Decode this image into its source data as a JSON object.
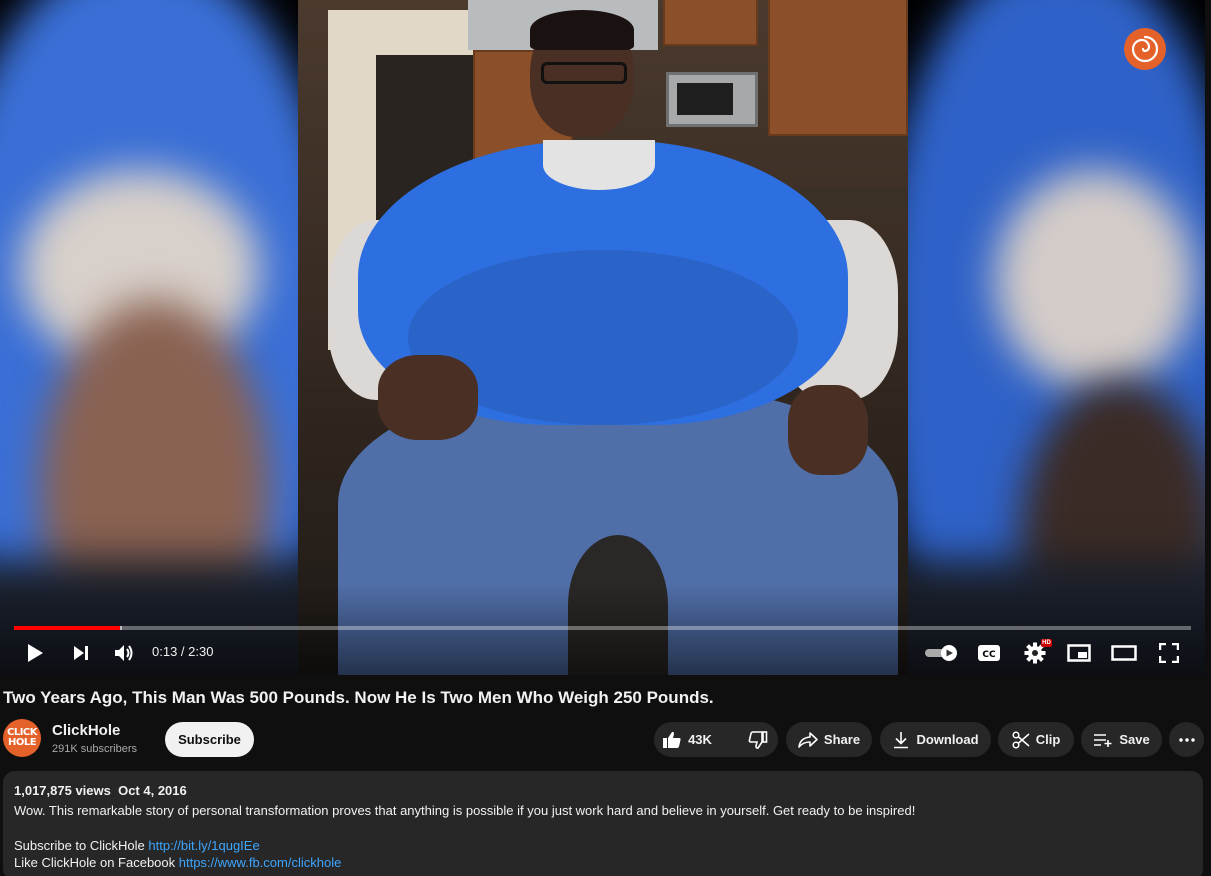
{
  "player": {
    "current_time": "0:13",
    "time_separator": " / ",
    "duration": "2:30",
    "progress_played": 0.09,
    "progress_loaded": 0.092,
    "hd_badge": "HD",
    "controls": [
      "play-icon",
      "next-icon",
      "volume-icon",
      "autoplay-toggle",
      "cc-icon",
      "settings-icon",
      "miniplayer-icon",
      "theater-icon",
      "fullscreen-icon"
    ]
  },
  "video": {
    "title": "Two Years Ago, This Man Was 500 Pounds. Now He Is Two Men Who Weigh 250 Pounds."
  },
  "channel": {
    "name": "ClickHole",
    "subscribers": "291K subscribers",
    "avatar_line1": "CLICK",
    "avatar_line2": "HOLE",
    "subscribe_label": "Subscribe",
    "brand_color": "#e4622a"
  },
  "actions": {
    "likes": "43K",
    "share": "Share",
    "download": "Download",
    "clip": "Clip",
    "save": "Save"
  },
  "description": {
    "views": "1,017,875 views",
    "date": "Oct 4, 2016",
    "text": "Wow. This remarkable story of personal transformation proves that anything is possible if you just work hard and believe in yourself. Get ready to be inspired!",
    "subscribe_label": "Subscribe to ClickHole ",
    "subscribe_link": "http://bit.ly/1qugIEe",
    "facebook_label": "Like ClickHole on Facebook ",
    "facebook_link": "https://www.fb.com/clickhole"
  },
  "colors": {
    "background": "#0f0f0f",
    "pill": "#272727",
    "progress": "#ff0000",
    "link": "#3ea6ff"
  }
}
